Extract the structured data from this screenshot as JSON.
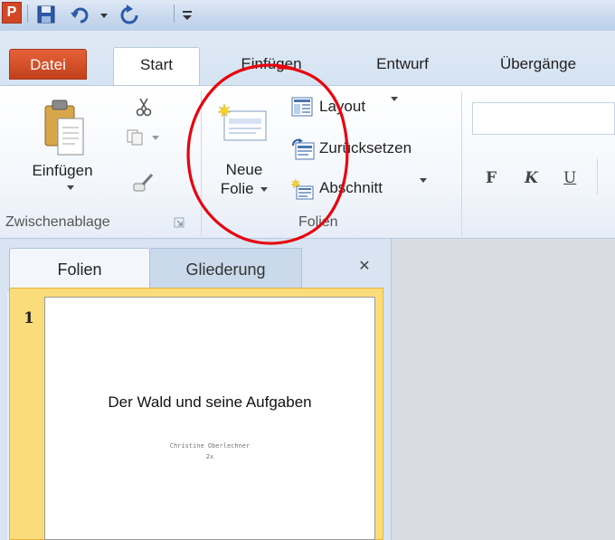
{
  "qat": {
    "app_letter": "P"
  },
  "tabs": {
    "datei": "Datei",
    "start": "Start",
    "einfuegen": "Einfügen",
    "entwurf": "Entwurf",
    "uebergaenge": "Übergänge"
  },
  "clipboard": {
    "paste_label": "Einfügen",
    "group_label": "Zwischenablage"
  },
  "slides_group": {
    "new_slide_line1": "Neue",
    "new_slide_line2": "Folie",
    "layout": "Layout",
    "reset": "Zurücksetzen",
    "section": "Abschnitt",
    "group_label": "Folien"
  },
  "font": {
    "bold": "F",
    "italic": "K",
    "underline": "U"
  },
  "pane": {
    "tab_slides": "Folien",
    "tab_outline": "Gliederung",
    "close_glyph": "✕"
  },
  "slide": {
    "number": "1",
    "title": "Der Wald und seine Aufgaben",
    "author": "Christine Oberlechner",
    "class": "2x"
  },
  "colors": {
    "accent_file_tab": "#d24726",
    "ribbon_bg": "#dfe9f5",
    "selection_frame": "#fbdc7a",
    "annotation_red": "#e8000d"
  }
}
